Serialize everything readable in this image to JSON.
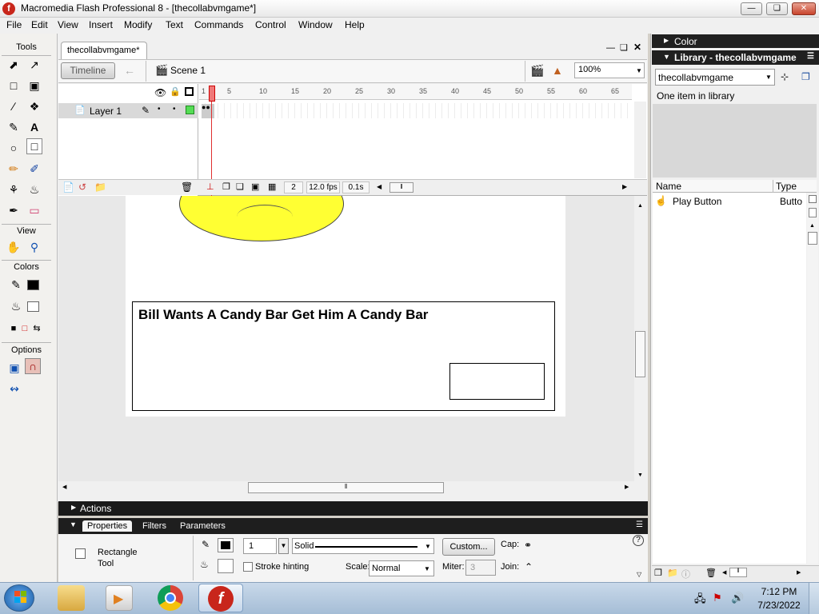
{
  "window": {
    "title": "Macromedia Flash Professional 8 - [thecollabvmgame*]",
    "controls": [
      "minimize",
      "restore",
      "close"
    ]
  },
  "menu": [
    "File",
    "Edit",
    "View",
    "Insert",
    "Modify",
    "Text",
    "Commands",
    "Control",
    "Window",
    "Help"
  ],
  "tools": {
    "header": "Tools",
    "view_header": "View",
    "colors_header": "Colors",
    "options_header": "Options"
  },
  "document": {
    "tab": "thecollabvmgame*",
    "timeline_button": "Timeline",
    "scene": "Scene 1",
    "zoom": "100%"
  },
  "timeline": {
    "layer_name": "Layer 1",
    "ruler": [
      "1",
      "5",
      "10",
      "15",
      "20",
      "25",
      "30",
      "35",
      "40",
      "45",
      "50",
      "55",
      "60",
      "65"
    ],
    "current_frame": "2",
    "fps": "12.0 fps",
    "elapsed": "0.1s"
  },
  "stage": {
    "heading": "Bill Wants A Candy Bar Get Him A Candy Bar",
    "smiley_color": "#ffff33"
  },
  "panels": {
    "actions": "Actions",
    "tabs": [
      "Properties",
      "Filters",
      "Parameters"
    ]
  },
  "properties": {
    "tool_line1": "Rectangle",
    "tool_line2": "Tool",
    "stroke_weight": "1",
    "stroke_style": "Solid",
    "custom_button": "Custom...",
    "cap_label": "Cap:",
    "stroke_hinting": "Stroke hinting",
    "scale_label": "Scale:",
    "scale_value": "Normal",
    "miter_label": "Miter:",
    "miter_value": "3",
    "join_label": "Join:"
  },
  "right_panel": {
    "color_title": "Color",
    "library_title": "Library - thecollabvmgame",
    "library_select": "thecollabvmgame",
    "item_count": "One item in library",
    "col_name": "Name",
    "col_type": "Type",
    "items": [
      {
        "name": "Play Button",
        "type": "Butto"
      }
    ]
  },
  "taskbar": {
    "time": "7:12 PM",
    "date": "7/23/2022"
  }
}
